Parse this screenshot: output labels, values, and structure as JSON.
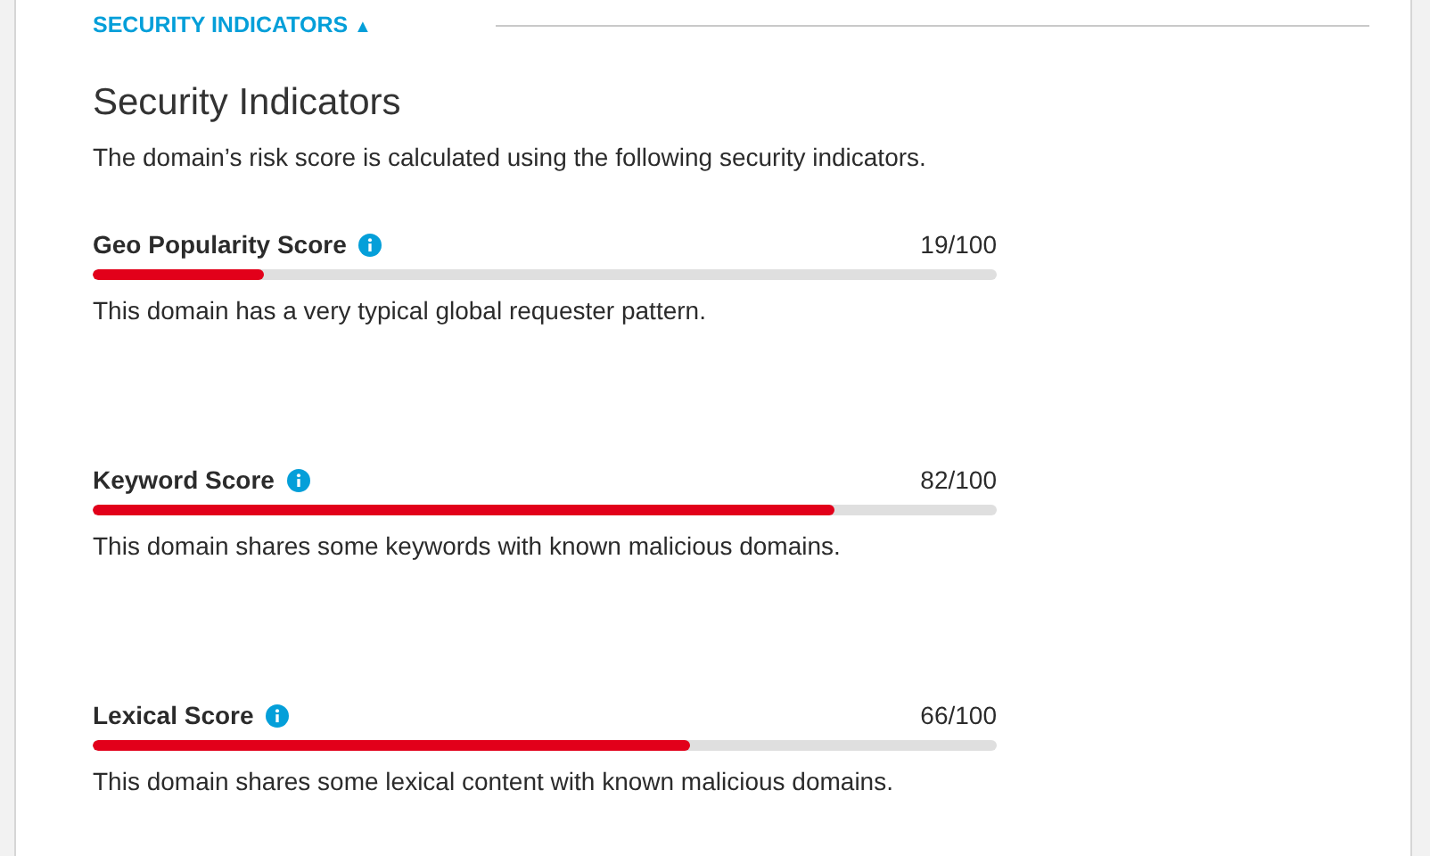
{
  "section_toggle": {
    "label": "SECURITY INDICATORS",
    "caret": "▲",
    "expanded": true
  },
  "title": "Security Indicators",
  "description": "The domain’s risk score is calculated using the following security indicators.",
  "indicators": [
    {
      "name": "Geo Popularity Score",
      "score": "19/100",
      "level": 0.19,
      "note": "This domain has a very typical global requester pattern."
    },
    {
      "name": "Keyword Score",
      "score": "82/100",
      "level": 0.82,
      "note": "This domain shares some keywords with known malicious domains."
    },
    {
      "name": "Lexical Score",
      "score": "66/100",
      "level": 0.66,
      "note": "This domain shares some lexical content with known malicious domains."
    }
  ]
}
